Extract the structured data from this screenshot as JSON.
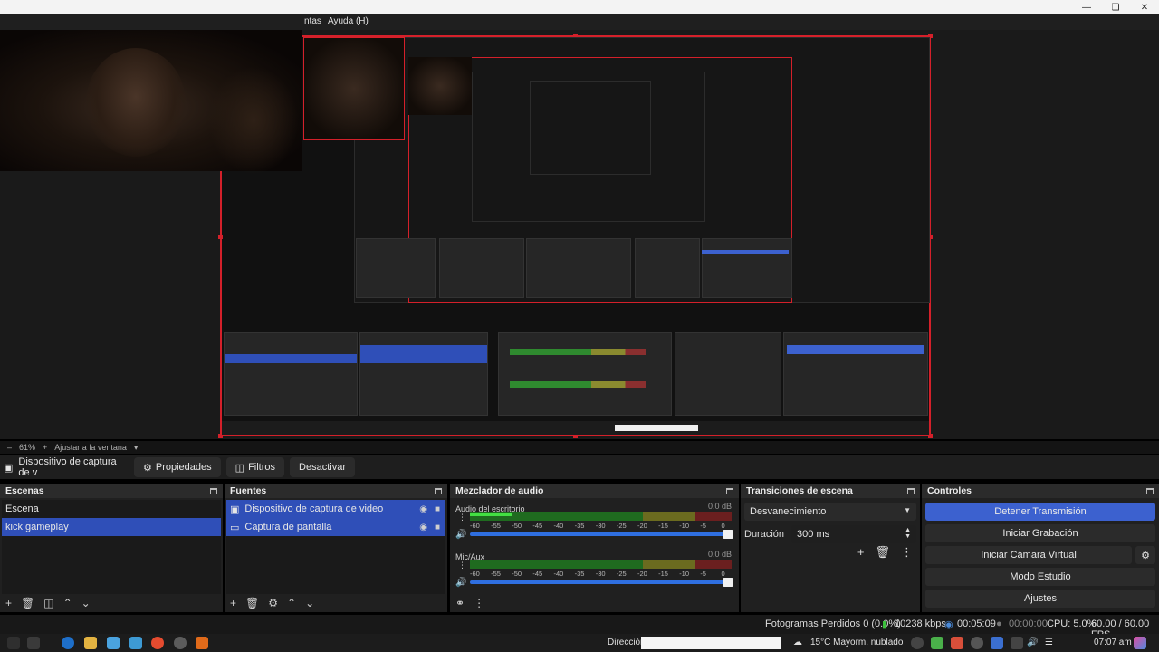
{
  "menu": {
    "tools_partial": "ntas",
    "help": "Ayuda (H)"
  },
  "preview": {
    "zoom": "61%",
    "fit_label": "Ajustar a la ventana"
  },
  "source_toolbar": {
    "selected_source": "Dispositivo de captura de v",
    "properties": "Propiedades",
    "filters": "Filtros",
    "deactivate": "Desactivar"
  },
  "scenes": {
    "title": "Escenas",
    "items": [
      "Escena",
      "kick gameplay"
    ],
    "selected": 1
  },
  "sources": {
    "title": "Fuentes",
    "items": [
      "Dispositivo de captura de video",
      "Captura de pantalla"
    ]
  },
  "mixer": {
    "title": "Mezclador de audio",
    "channels": [
      {
        "name": "Audio del escritorio",
        "db": "0.0 dB",
        "level": 0.16
      },
      {
        "name": "Mic/Aux",
        "db": "0.0 dB",
        "level": 0.0
      }
    ],
    "scale": [
      "-60",
      "-55",
      "-50",
      "-45",
      "-40",
      "-35",
      "-30",
      "-25",
      "-20",
      "-15",
      "-10",
      "-5",
      "0"
    ]
  },
  "transitions": {
    "title": "Transiciones de escena",
    "selected": "Desvanecimiento",
    "duration_label": "Duración",
    "duration_value": "300 ms"
  },
  "controls": {
    "title": "Controles",
    "stop_stream": "Detener Transmisión",
    "start_recording": "Iniciar Grabación",
    "start_virtual_cam": "Iniciar Cámara Virtual",
    "studio_mode": "Modo Estudio",
    "settings": "Ajustes"
  },
  "status": {
    "dropped_frames": "Fotogramas Perdidos 0 (0.0%)",
    "bitrate": "10238 kbps",
    "stream_time": "00:05:09",
    "rec_time": "00:00:00",
    "cpu": "CPU: 5.0%",
    "fps": "60.00 / 60.00 FPS"
  },
  "taskbar": {
    "address_label": "Dirección",
    "weather": "15°C  Mayorm. nublado",
    "clock": "07:07 am"
  },
  "colors": {
    "accent": "#3c61cf",
    "selection": "#2f4fb8",
    "preview_border": "#d4202a"
  }
}
